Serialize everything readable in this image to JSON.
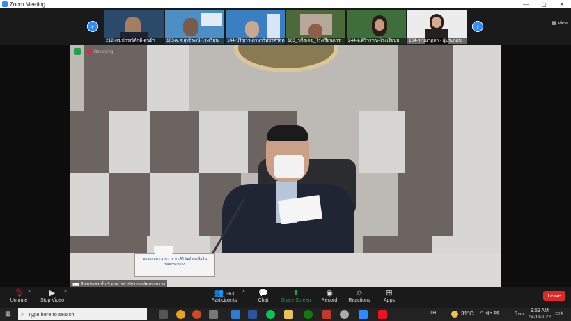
{
  "window": {
    "title": "Zoom Meeting",
    "controls": [
      "—",
      "▢",
      "✕"
    ]
  },
  "participants_strip": {
    "prev_icon": "chevron-left",
    "next_icon": "chevron-right",
    "view_label": "View",
    "thumbnails": [
      {
        "name": "212-ดร.ปกรณ์ศักดิ์-ศูนย์ฯ"
      },
      {
        "name": "103-ผ.ศ.สุทธิพงษ์-โรงเรียน"
      },
      {
        "name": "144-ปริญาร-ภาษาวิทยาศาสตร์"
      },
      {
        "name": "163_ขจิรเดช_โรงเรียนการ"
      },
      {
        "name": "244-อ.ศิริวรรณ-โรงเรียนบ"
      },
      {
        "name": "164-ร-ขนาฏกา - ผู้ประกอบ"
      }
    ]
  },
  "stage": {
    "recording_label": "Recording",
    "nameplate": "นายกฤษฎา มหาราช ดร.ศิริวัฒน์ ผลเพิ่มสิน",
    "subtitle": "ปลัดกระทรวง",
    "signal_label": "ห้องประชุมชั้น 5 อาคารสำนักงานปลัดกระทรวง"
  },
  "toolbar": {
    "unmute": "Unmute",
    "stop_video": "Stop Video",
    "participants": "Participants",
    "participants_count": "363",
    "chat": "Chat",
    "share_screen": "Share Screen",
    "record": "Record",
    "reactions": "Reactions",
    "apps": "Apps",
    "leave": "Leave"
  },
  "taskbar": {
    "search_placeholder": "Type here to search",
    "lang": "TH",
    "temp": "31°C",
    "ime": "ไทย",
    "time": "9:59 AM",
    "date": "5/20/2022",
    "notif_count": "4"
  },
  "colors": {
    "accent": "#2d8cff",
    "leave": "#e02828",
    "share": "#1ea446"
  }
}
